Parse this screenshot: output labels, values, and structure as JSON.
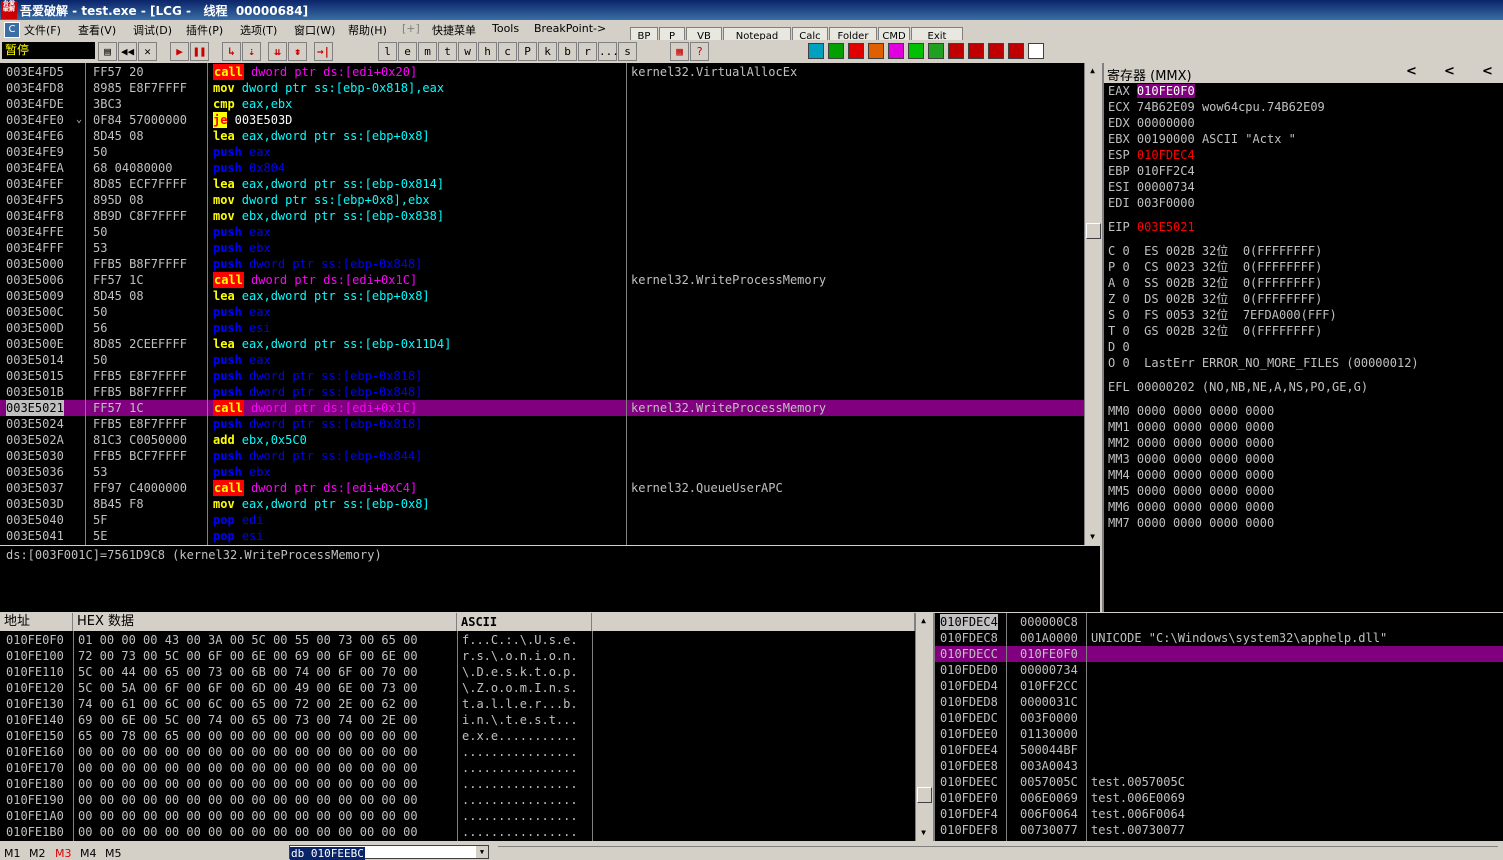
{
  "window": {
    "title": "吾爱破解 - test.exe - [LCG -   线程  00000684]",
    "logo": "吾爱破解"
  },
  "menu": {
    "items": [
      "文件(F)",
      "查看(V)",
      "调试(D)",
      "插件(P)",
      "选项(T)",
      "窗口(W)",
      "帮助(H)",
      "[+]",
      "快捷菜单",
      "Tools",
      "BreakPoint->"
    ],
    "buttons": [
      "BP",
      "P",
      "VB",
      "Notepad",
      "Calc",
      "Folder",
      "CMD",
      "Exit"
    ]
  },
  "toolbar": {
    "status": "暂停",
    "nav_buttons": [
      "▶◀",
      "◀◀",
      "✕",
      "▶",
      "❚❚",
      "↳",
      "⇣",
      "⇊",
      "⇟",
      "→|"
    ],
    "letters": [
      "l",
      "e",
      "m",
      "t",
      "w",
      "h",
      "c",
      "P",
      "k",
      "b",
      "r",
      "...",
      "s"
    ],
    "colors": [
      "#00a0c0",
      "#00a000",
      "#e00000",
      "#e06000",
      "#e000e0",
      "#00c000",
      "#20a020",
      "#c00000",
      "#c00000",
      "#c00000",
      "#c00000",
      "#ffffff"
    ]
  },
  "disasm": {
    "rows": [
      {
        "addr": "003E4FD5",
        "mark": "",
        "hex": "FF57 20",
        "mn": "call",
        "mk": "call",
        "op": "dword ptr ds:[edi+0x20]",
        "cm": "kernel32.VirtualAllocEx"
      },
      {
        "addr": "003E4FD8",
        "mark": "",
        "hex": "8985 E8F7FFFF",
        "mn": "mov",
        "mk": "mov",
        "op": "dword ptr ss:[ebp-0x818],eax",
        "cm": ""
      },
      {
        "addr": "003E4FDE",
        "mark": "",
        "hex": "3BC3",
        "mn": "cmp",
        "mk": "mov",
        "op": "eax,ebx",
        "cm": ""
      },
      {
        "addr": "003E4FE0",
        "mark": "⌄",
        "hex": "0F84 57000000",
        "mn": "je",
        "mk": "je",
        "op": "003E503D",
        "cm": ""
      },
      {
        "addr": "003E4FE6",
        "mark": "",
        "hex": "8D45 08",
        "mn": "lea",
        "mk": "mov",
        "op": "eax,dword ptr ss:[ebp+0x8]",
        "cm": ""
      },
      {
        "addr": "003E4FE9",
        "mark": "",
        "hex": "50",
        "mn": "push",
        "mk": "push",
        "op": "eax",
        "cm": ""
      },
      {
        "addr": "003E4FEA",
        "mark": "",
        "hex": "68 04080000",
        "mn": "push",
        "mk": "push",
        "op": "0x804",
        "cm": ""
      },
      {
        "addr": "003E4FEF",
        "mark": "",
        "hex": "8D85 ECF7FFFF",
        "mn": "lea",
        "mk": "mov",
        "op": "eax,dword ptr ss:[ebp-0x814]",
        "cm": ""
      },
      {
        "addr": "003E4FF5",
        "mark": "",
        "hex": "895D 08",
        "mn": "mov",
        "mk": "mov",
        "op": "dword ptr ss:[ebp+0x8],ebx",
        "cm": ""
      },
      {
        "addr": "003E4FF8",
        "mark": "",
        "hex": "8B9D C8F7FFFF",
        "mn": "mov",
        "mk": "mov",
        "op": "ebx,dword ptr ss:[ebp-0x838]",
        "cm": ""
      },
      {
        "addr": "003E4FFE",
        "mark": "",
        "hex": "50",
        "mn": "push",
        "mk": "push",
        "op": "eax",
        "cm": ""
      },
      {
        "addr": "003E4FFF",
        "mark": "",
        "hex": "53",
        "mn": "push",
        "mk": "push",
        "op": "ebx",
        "cm": ""
      },
      {
        "addr": "003E5000",
        "mark": "",
        "hex": "FFB5 B8F7FFFF",
        "mn": "push",
        "mk": "push",
        "op": "dword ptr ss:[ebp-0x848]",
        "cm": ""
      },
      {
        "addr": "003E5006",
        "mark": "",
        "hex": "FF57 1C",
        "mn": "call",
        "mk": "call",
        "op": "dword ptr ds:[edi+0x1C]",
        "cm": "kernel32.WriteProcessMemory"
      },
      {
        "addr": "003E5009",
        "mark": "",
        "hex": "8D45 08",
        "mn": "lea",
        "mk": "mov",
        "op": "eax,dword ptr ss:[ebp+0x8]",
        "cm": ""
      },
      {
        "addr": "003E500C",
        "mark": "",
        "hex": "50",
        "mn": "push",
        "mk": "push",
        "op": "eax",
        "cm": ""
      },
      {
        "addr": "003E500D",
        "mark": "",
        "hex": "56",
        "mn": "push",
        "mk": "push",
        "op": "esi",
        "cm": ""
      },
      {
        "addr": "003E500E",
        "mark": "",
        "hex": "8D85 2CEEFFFF",
        "mn": "lea",
        "mk": "mov",
        "op": "eax,dword ptr ss:[ebp-0x11D4]",
        "cm": ""
      },
      {
        "addr": "003E5014",
        "mark": "",
        "hex": "50",
        "mn": "push",
        "mk": "push",
        "op": "eax",
        "cm": ""
      },
      {
        "addr": "003E5015",
        "mark": "",
        "hex": "FFB5 E8F7FFFF",
        "mn": "push",
        "mk": "push",
        "op": "dword ptr ss:[ebp-0x818]",
        "cm": ""
      },
      {
        "addr": "003E501B",
        "mark": "",
        "hex": "FFB5 B8F7FFFF",
        "mn": "push",
        "mk": "push",
        "op": "dword ptr ss:[ebp-0x848]",
        "cm": ""
      },
      {
        "addr": "003E5021",
        "mark": "",
        "hex": "FF57 1C",
        "mn": "call",
        "mk": "call",
        "op": "dword ptr ds:[edi+0x1C]",
        "cm": "kernel32.WriteProcessMemory",
        "sel": true
      },
      {
        "addr": "003E5024",
        "mark": "",
        "hex": "FFB5 E8F7FFFF",
        "mn": "push",
        "mk": "push",
        "op": "dword ptr ss:[ebp-0x818]",
        "cm": ""
      },
      {
        "addr": "003E502A",
        "mark": "",
        "hex": "81C3 C0050000",
        "mn": "add",
        "mk": "mov",
        "op": "ebx,0x5C0",
        "cm": ""
      },
      {
        "addr": "003E5030",
        "mark": "",
        "hex": "FFB5 BCF7FFFF",
        "mn": "push",
        "mk": "push",
        "op": "dword ptr ss:[ebp-0x844]",
        "cm": ""
      },
      {
        "addr": "003E5036",
        "mark": "",
        "hex": "53",
        "mn": "push",
        "mk": "push",
        "op": "ebx",
        "cm": ""
      },
      {
        "addr": "003E5037",
        "mark": "",
        "hex": "FF97 C4000000",
        "mn": "call",
        "mk": "call",
        "op": "dword ptr ds:[edi+0xC4]",
        "cm": "kernel32.QueueUserAPC"
      },
      {
        "addr": "003E503D",
        "mark": "",
        "hex": "8B45 F8",
        "mn": "mov",
        "mk": "mov",
        "op": "eax,dword ptr ss:[ebp-0x8]",
        "cm": ""
      },
      {
        "addr": "003E5040",
        "mark": "",
        "hex": "5F",
        "mn": "pop",
        "mk": "push",
        "op": "edi",
        "cm": ""
      },
      {
        "addr": "003E5041",
        "mark": "",
        "hex": "5E",
        "mn": "pop",
        "mk": "push",
        "op": "esi",
        "cm": ""
      }
    ]
  },
  "info": {
    "text": "ds:[003F001C]=7561D9C8 (kernel32.WriteProcessMemory)"
  },
  "registers": {
    "title": "寄存器 (MMX)",
    "nav": [
      "<",
      "<",
      "<"
    ],
    "gpr": [
      {
        "n": "EAX",
        "v": "010FE0F0",
        "c": "",
        "hl": true
      },
      {
        "n": "ECX",
        "v": "74B62E09",
        "c": "wow64cpu.74B62E09",
        "hl": false
      },
      {
        "n": "EDX",
        "v": "00000000",
        "c": "",
        "hl": false
      },
      {
        "n": "EBX",
        "v": "00190000",
        "c": "ASCII \"Actx \"",
        "hl": false
      },
      {
        "n": "ESP",
        "v": "010FDEC4",
        "c": "",
        "hl": false,
        "red": true
      },
      {
        "n": "EBP",
        "v": "010FF2C4",
        "c": "",
        "hl": false
      },
      {
        "n": "ESI",
        "v": "00000734",
        "c": "",
        "hl": false
      },
      {
        "n": "EDI",
        "v": "003F0000",
        "c": "",
        "hl": false
      }
    ],
    "eip": {
      "n": "EIP",
      "v": "003E5021"
    },
    "flags": [
      "C 0  ES 002B 32位  0(FFFFFFFF)",
      "P 0  CS 0023 32位  0(FFFFFFFF)",
      "A 0  SS 002B 32位  0(FFFFFFFF)",
      "Z 0  DS 002B 32位  0(FFFFFFFF)",
      "S 0  FS 0053 32位  7EFDA000(FFF)",
      "T 0  GS 002B 32位  0(FFFFFFFF)",
      "D 0",
      "O 0  LastErr ERROR_NO_MORE_FILES (00000012)"
    ],
    "efl": "EFL 00000202 (NO,NB,NE,A,NS,PO,GE,G)",
    "mmx": [
      "MM0 0000 0000 0000 0000",
      "MM1 0000 0000 0000 0000",
      "MM2 0000 0000 0000 0000",
      "MM3 0000 0000 0000 0000",
      "MM4 0000 0000 0000 0000",
      "MM5 0000 0000 0000 0000",
      "MM6 0000 0000 0000 0000",
      "MM7 0000 0000 0000 0000"
    ]
  },
  "dump": {
    "headers": [
      "地址",
      "HEX 数据",
      "ASCII"
    ],
    "rows": [
      {
        "a": "010FE0F0",
        "h": "01 00 00 00 43 00 3A 00 5C 00 55 00 73 00 65 00",
        "s": "f...C.:.\\.U.s.e."
      },
      {
        "a": "010FE100",
        "h": "72 00 73 00 5C 00 6F 00 6E 00 69 00 6F 00 6E 00",
        "s": "r.s.\\.o.n.i.o.n."
      },
      {
        "a": "010FE110",
        "h": "5C 00 44 00 65 00 73 00 6B 00 74 00 6F 00 70 00",
        "s": "\\.D.e.s.k.t.o.p."
      },
      {
        "a": "010FE120",
        "h": "5C 00 5A 00 6F 00 6F 00 6D 00 49 00 6E 00 73 00",
        "s": "\\.Z.o.o.m.I.n.s."
      },
      {
        "a": "010FE130",
        "h": "74 00 61 00 6C 00 6C 00 65 00 72 00 2E 00 62 00",
        "s": "t.a.l.l.e.r...b."
      },
      {
        "a": "010FE140",
        "h": "69 00 6E 00 5C 00 74 00 65 00 73 00 74 00 2E 00",
        "s": "i.n.\\.t.e.s.t..."
      },
      {
        "a": "010FE150",
        "h": "65 00 78 00 65 00 00 00 00 00 00 00 00 00 00 00",
        "s": "e.x.e..........."
      },
      {
        "a": "010FE160",
        "h": "00 00 00 00 00 00 00 00 00 00 00 00 00 00 00 00",
        "s": "................"
      },
      {
        "a": "010FE170",
        "h": "00 00 00 00 00 00 00 00 00 00 00 00 00 00 00 00",
        "s": "................"
      },
      {
        "a": "010FE180",
        "h": "00 00 00 00 00 00 00 00 00 00 00 00 00 00 00 00",
        "s": "................"
      },
      {
        "a": "010FE190",
        "h": "00 00 00 00 00 00 00 00 00 00 00 00 00 00 00 00",
        "s": "................"
      },
      {
        "a": "010FE1A0",
        "h": "00 00 00 00 00 00 00 00 00 00 00 00 00 00 00 00",
        "s": "................"
      },
      {
        "a": "010FE1B0",
        "h": "00 00 00 00 00 00 00 00 00 00 00 00 00 00 00 00",
        "s": "................"
      }
    ]
  },
  "stack": {
    "rows": [
      {
        "a": "010FDEC4",
        "v": "000000C8",
        "c": "",
        "top": true
      },
      {
        "a": "010FDEC8",
        "v": "001A0000",
        "c": "UNICODE \"C:\\Windows\\system32\\apphelp.dll\""
      },
      {
        "a": "010FDECC",
        "v": "010FE0F0",
        "c": "",
        "sel": true
      },
      {
        "a": "010FDED0",
        "v": "00000734",
        "c": ""
      },
      {
        "a": "010FDED4",
        "v": "010FF2CC",
        "c": ""
      },
      {
        "a": "010FDED8",
        "v": "0000031C",
        "c": ""
      },
      {
        "a": "010FDEDC",
        "v": "003F0000",
        "c": ""
      },
      {
        "a": "010FDEE0",
        "v": "01130000",
        "c": ""
      },
      {
        "a": "010FDEE4",
        "v": "500044BF",
        "c": ""
      },
      {
        "a": "010FDEE8",
        "v": "003A0043",
        "c": ""
      },
      {
        "a": "010FDEEC",
        "v": "0057005C",
        "c": "test.0057005C"
      },
      {
        "a": "010FDEF0",
        "v": "006E0069",
        "c": "test.006E0069"
      },
      {
        "a": "010FDEF4",
        "v": "006F0064",
        "c": "test.006F0064"
      },
      {
        "a": "010FDEF8",
        "v": "00730077",
        "c": "test.00730077"
      }
    ]
  },
  "statusbar": {
    "mtabs": [
      "M1",
      "M2",
      "M3",
      "M4",
      "M5"
    ],
    "command": "db 010FEEBC"
  }
}
